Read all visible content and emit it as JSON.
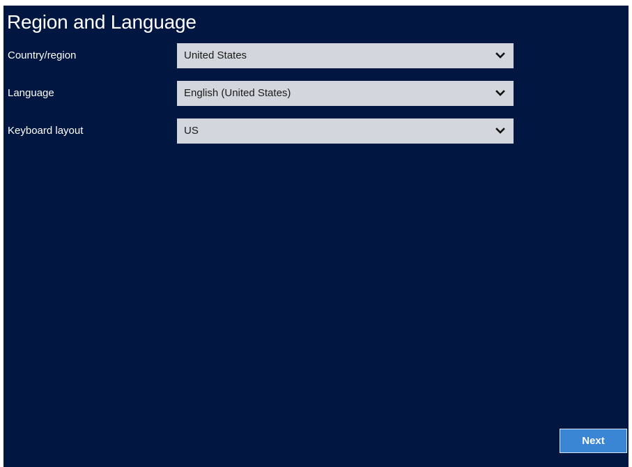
{
  "page": {
    "title": "Region and Language"
  },
  "fields": [
    {
      "label": "Country/region",
      "value": "United States"
    },
    {
      "label": "Language",
      "value": "English (United States)"
    },
    {
      "label": "Keyboard layout",
      "value": "US"
    }
  ],
  "actions": {
    "next_label": "Next"
  },
  "icons": {
    "dropdown": "chevron-down-icon"
  },
  "colors": {
    "background": "#011640",
    "select_bg": "#d4d6de",
    "button_bg": "#3a86d4",
    "text": "#ffffff"
  }
}
